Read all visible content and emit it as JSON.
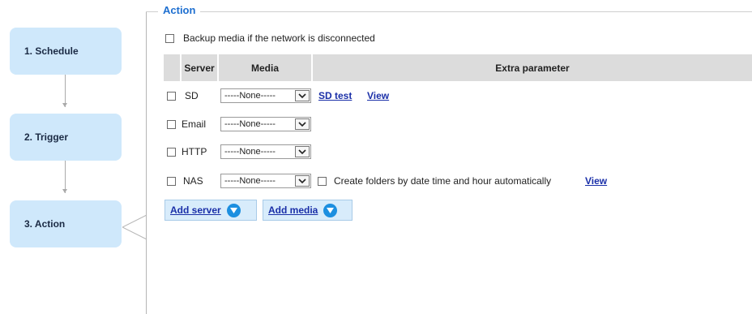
{
  "steps": [
    {
      "label": "1. Schedule"
    },
    {
      "label": "2. Trigger"
    },
    {
      "label": "3. Action"
    }
  ],
  "section": {
    "legend": "Action"
  },
  "backup": {
    "label": "Backup media if the network is disconnected",
    "checked": false
  },
  "table": {
    "headers": {
      "server": "Server",
      "media": "Media",
      "extra": "Extra parameter"
    },
    "rows": [
      {
        "server": "SD",
        "media": "-----None-----",
        "links": [
          "SD test",
          "View"
        ]
      },
      {
        "server": "Email",
        "media": "-----None-----"
      },
      {
        "server": "HTTP",
        "media": "-----None-----"
      },
      {
        "server": "NAS",
        "media": "-----None-----",
        "folder_label": "Create folders by date time and hour automatically",
        "view_label": "View"
      }
    ]
  },
  "buttons": {
    "add_server": "Add server",
    "add_media": "Add media"
  },
  "colors": {
    "step_bg": "#cfe8fb",
    "legend": "#1e6fd0",
    "link": "#1a2fa8",
    "header_bg": "#dcdcdc",
    "button_bg": "#d8ecfb",
    "button_icon": "#1c8fe0"
  }
}
